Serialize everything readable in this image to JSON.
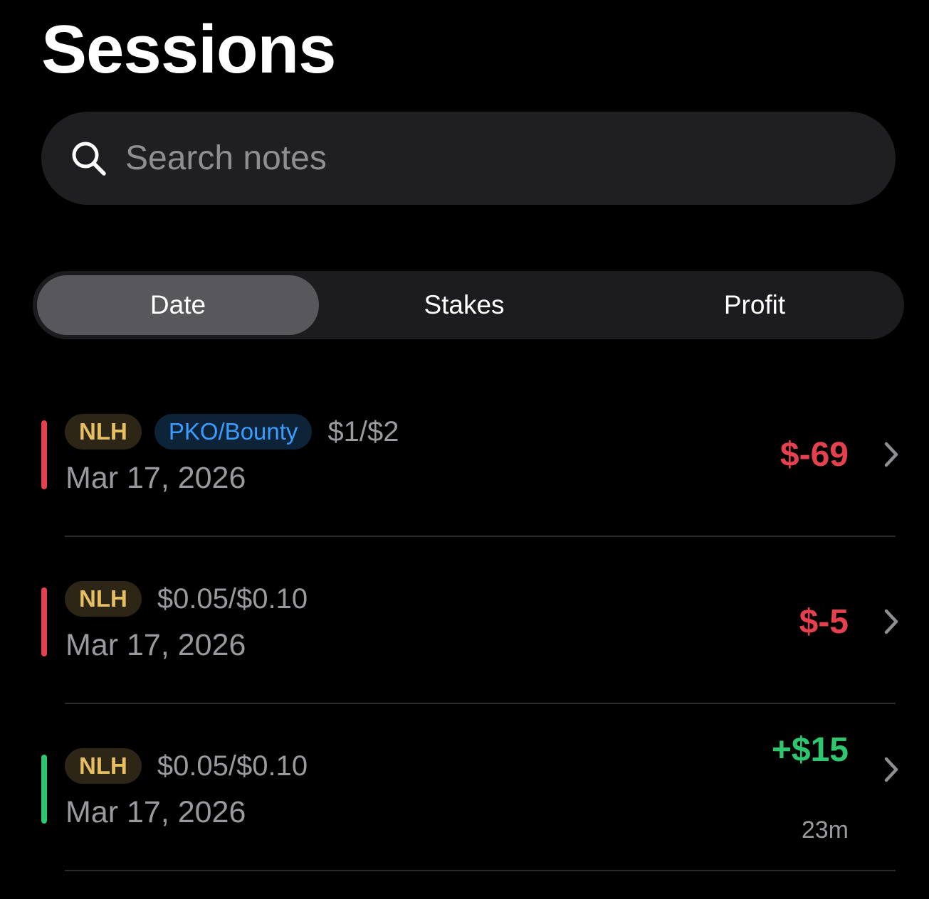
{
  "header": {
    "title": "Sessions"
  },
  "search": {
    "placeholder": "Search notes",
    "value": ""
  },
  "sort": {
    "options": [
      {
        "label": "Date",
        "selected": true
      },
      {
        "label": "Stakes",
        "selected": false
      },
      {
        "label": "Profit",
        "selected": false
      }
    ]
  },
  "colors": {
    "loss": "#e5404e",
    "win": "#2ec770",
    "badge_nlh": "#e5bf62",
    "badge_pko": "#3a9cff"
  },
  "sessions": [
    {
      "game": "NLH",
      "format": "PKO/Bounty",
      "stakes": "$1/$2",
      "date": "Mar 17, 2026",
      "profit": "$-69",
      "duration": "",
      "result": "loss"
    },
    {
      "game": "NLH",
      "format": "",
      "stakes": "$0.05/$0.10",
      "date": "Mar 17, 2026",
      "profit": "$-5",
      "duration": "",
      "result": "loss"
    },
    {
      "game": "NLH",
      "format": "",
      "stakes": "$0.05/$0.10",
      "date": "Mar 17, 2026",
      "profit": "+$15",
      "duration": "23m",
      "result": "win"
    }
  ],
  "icons": {
    "search": "search-icon",
    "chevron": "chevron-right-icon"
  }
}
